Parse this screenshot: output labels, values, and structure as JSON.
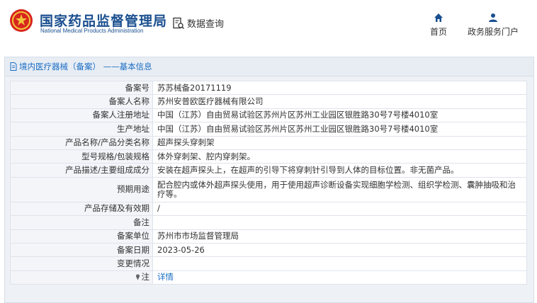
{
  "header": {
    "brand_cn": "国家药品监督管理局",
    "brand_en": "National Medical Products Administration",
    "query_label": "数据查询",
    "nav": [
      {
        "label": "首页",
        "icon": "home-icon"
      },
      {
        "label": "政务服务门户",
        "icon": "user-icon"
      }
    ],
    "brand_color": "#1a4f8f"
  },
  "panel": {
    "title": "境内医疗器械（备案） ——基本信息",
    "title_icon": "document-icon",
    "accent": "#1a6dc4"
  },
  "record": {
    "rows": [
      {
        "label": "备案号",
        "value": "苏苏械备20171119"
      },
      {
        "label": "备案人名称",
        "value": "苏州安普欧医疗器械有限公司"
      },
      {
        "label": "备案人注册地址",
        "value": "中国（江苏）自由贸易试验区苏州片区苏州工业园区银胜路30号7号楼4010室"
      },
      {
        "label": "生产地址",
        "value": "中国（江苏）自由贸易试验区苏州片区苏州工业园区银胜路30号7号楼4010室"
      },
      {
        "label": "产品名称/产品分类名称",
        "value": "超声探头穿刺架"
      },
      {
        "label": "型号规格/包装规格",
        "value": "体外穿刺架、腔内穿刺架。"
      },
      {
        "label": "产品描述/主要组成成分",
        "value": "安装在超声探头上，在超声的引导下将穿刺针引导到人体的目标位置。非无菌产品。"
      },
      {
        "label": "预期用途",
        "value": "配合腔内或体外超声探头使用，用于使用超声诊断设备实现细胞学检测、组织学检测、囊肿抽吸和治疗等。"
      },
      {
        "label": "产品存储及有效期",
        "value": "/"
      },
      {
        "label": "备注",
        "value": ""
      },
      {
        "label": "备案单位",
        "value": "苏州市市场监督管理局"
      },
      {
        "label": "备案日期",
        "value": "2023-05-26"
      },
      {
        "label": "变更情况",
        "value": ""
      }
    ],
    "note_label": "注",
    "note_icon": "pin-icon",
    "note_link": "详情"
  }
}
